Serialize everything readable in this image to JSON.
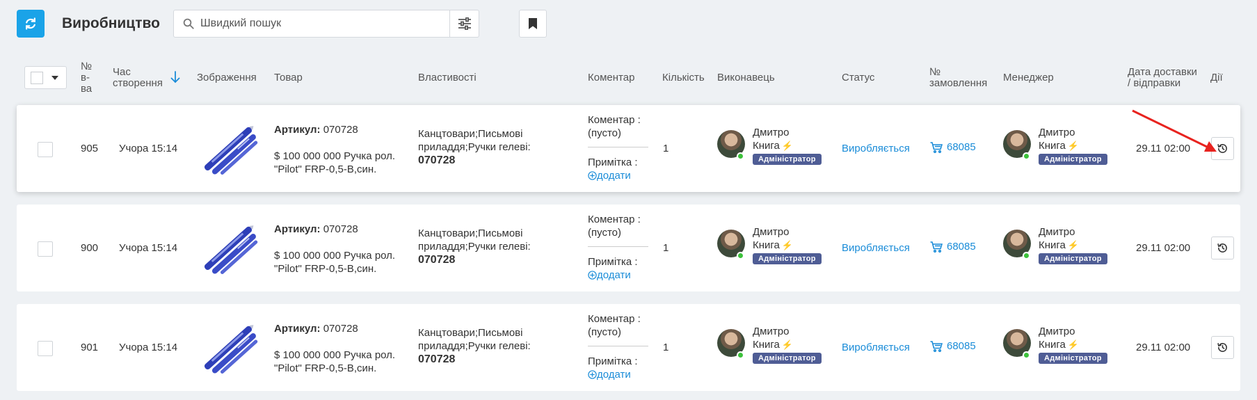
{
  "topbar": {
    "title": "Виробництво",
    "search_placeholder": "Швидкий пошук"
  },
  "table": {
    "headers": {
      "num": "№\nв-\nва",
      "created": "Час\nстворення",
      "image": "Зображення",
      "product": "Товар",
      "properties": "Властивості",
      "comment": "Коментар",
      "quantity": "Кількість",
      "executor": "Виконавець",
      "status": "Статус",
      "order": "№\nзамовлення",
      "manager": "Менеджер",
      "delivery": "Дата доставки\n/ відправки",
      "actions": "Дії"
    },
    "rows": [
      {
        "num": "905",
        "created": "Учора 15:14",
        "article_label": "Артикул:",
        "article": "070728",
        "product_name": "$ 100 000 000 Ручка рол. \"Pilot\" FRP-0,5-B,син.",
        "properties_text": "Канцтовари;Письмові приладдя;Ручки гелеві:",
        "properties_code": "070728",
        "comment_label": "Коментар :",
        "comment_value": "(пусто)",
        "note_label": "Примітка :",
        "note_add": "додати",
        "quantity": "1",
        "executor_first": "Дмитро",
        "executor_last": "Книга",
        "executor_role": "Адміністратор",
        "status": "Виробляється",
        "order": "68085",
        "manager_first": "Дмитро",
        "manager_last": "Книга",
        "manager_role": "Адміністратор",
        "delivery": "29.11 02:00"
      },
      {
        "num": "900",
        "created": "Учора 15:14",
        "article_label": "Артикул:",
        "article": "070728",
        "product_name": "$ 100 000 000 Ручка рол. \"Pilot\" FRP-0,5-B,син.",
        "properties_text": "Канцтовари;Письмові приладдя;Ручки гелеві:",
        "properties_code": "070728",
        "comment_label": "Коментар :",
        "comment_value": "(пусто)",
        "note_label": "Примітка :",
        "note_add": "додати",
        "quantity": "1",
        "executor_first": "Дмитро",
        "executor_last": "Книга",
        "executor_role": "Адміністратор",
        "status": "Виробляється",
        "order": "68085",
        "manager_first": "Дмитро",
        "manager_last": "Книга",
        "manager_role": "Адміністратор",
        "delivery": "29.11 02:00"
      },
      {
        "num": "901",
        "created": "Учора 15:14",
        "article_label": "Артикул:",
        "article": "070728",
        "product_name": "$ 100 000 000 Ручка рол. \"Pilot\" FRP-0,5-B,син.",
        "properties_text": "Канцтовари;Письмові приладдя;Ручки гелеві:",
        "properties_code": "070728",
        "comment_label": "Коментар :",
        "comment_value": "(пусто)",
        "note_label": "Примітка :",
        "note_add": "додати",
        "quantity": "1",
        "executor_first": "Дмитро",
        "executor_last": "Книга",
        "executor_role": "Адміністратор",
        "status": "Виробляється",
        "order": "68085",
        "manager_first": "Дмитро",
        "manager_last": "Книга",
        "manager_role": "Адміністратор",
        "delivery": "29.11 02:00"
      }
    ]
  },
  "colors": {
    "accent": "#1aa3e8",
    "link": "#1a8cd8",
    "role_badge": "#4f5d95",
    "online": "#3cc13b",
    "annotation_arrow": "#e8231f"
  },
  "icons": {
    "refresh": "refresh-icon",
    "search": "search-icon",
    "filter": "sliders-icon",
    "bookmark": "bookmark-icon",
    "sort": "arrow-down-icon",
    "cart": "cart-icon",
    "history": "history-icon",
    "add": "plus-circle-icon",
    "lightning": "lightning-icon"
  }
}
